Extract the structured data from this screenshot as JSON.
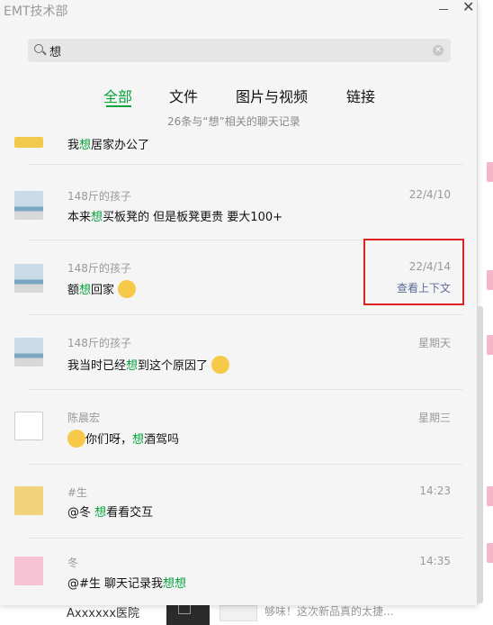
{
  "window": {
    "title": "EMT技术部"
  },
  "search": {
    "value": "想"
  },
  "tabs": [
    {
      "label": "全部"
    },
    {
      "label": "文件"
    },
    {
      "label": "图片与视频"
    },
    {
      "label": "链接"
    }
  ],
  "summary": "26条与“想”相关的聊天记录",
  "messages": [
    {
      "sender": "",
      "date": "",
      "pre": "我",
      "hl": "想",
      "post": "居家办公了",
      "post2": "",
      "hl2": ""
    },
    {
      "sender": "148斤的孩子",
      "date": "22/4/10",
      "pre": "本来",
      "hl": "想",
      "post": "买板凳的 但是板凳更贵 要大100+",
      "post2": "",
      "hl2": ""
    },
    {
      "sender": "148斤的孩子",
      "date": "22/4/14",
      "context": "查看上下文",
      "pre": "额",
      "hl": "想",
      "post": "回家",
      "post2": "",
      "hl2": ""
    },
    {
      "sender": "148斤的孩子",
      "date": "星期天",
      "pre": "我当时已经",
      "hl": "想",
      "post": "到这个原因了",
      "post2": "",
      "hl2": ""
    },
    {
      "sender": "陈晨宏",
      "date": "星期三",
      "pre": "你们呀，",
      "hl": "想",
      "post": "酒驾吗",
      "post2": "",
      "hl2": ""
    },
    {
      "sender": "#生",
      "date": "14:23",
      "pre": "@冬  ",
      "hl": "想",
      "post": "看看交互",
      "post2": "",
      "hl2": ""
    },
    {
      "sender": "冬",
      "date": "14:35",
      "pre": "@#生 聊天记录我",
      "hl": "想",
      "post": "",
      "post2": "",
      "hl2": "想"
    }
  ],
  "background": {
    "bottom_left_text": "Axxxxxx医院",
    "bottom_right_text": "够味！这次新品真的太捷..."
  },
  "colors": {
    "accent": "#07a23b",
    "highlight_box": "#e12020"
  }
}
